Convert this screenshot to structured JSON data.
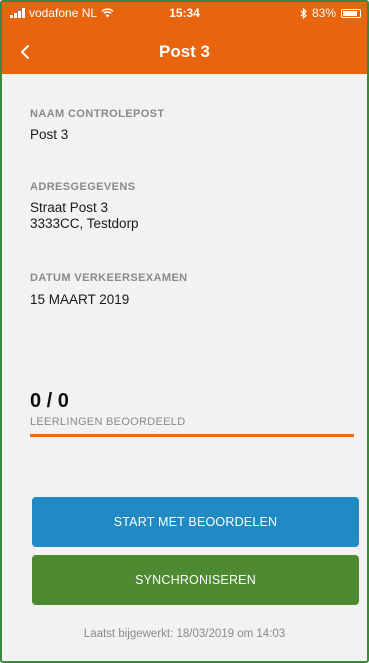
{
  "status_bar": {
    "carrier": "vodafone NL",
    "time": "15:34",
    "battery": "83%",
    "battery_level": 0.83
  },
  "nav": {
    "title": "Post 3",
    "back_icon": "chevron-left-icon"
  },
  "fields": {
    "naam": {
      "label": "NAAM CONTROLEPOST",
      "value": "Post 3"
    },
    "adres": {
      "label": "ADRESGEGEVENS",
      "line1": "Straat Post 3",
      "line2": "3333CC, Testdorp"
    },
    "datum": {
      "label": "DATUM VERKEERSEXAMEN",
      "value": "15 MAART 2019"
    }
  },
  "progress": {
    "count": "0 / 0",
    "label": "LEERLINGEN BEOORDEELD",
    "completed": 0,
    "total": 0
  },
  "buttons": {
    "start": "START MET BEOORDELEN",
    "sync": "SYNCHRONISEREN"
  },
  "footer": {
    "last_updated": "Laatst bijgewerkt: 18/03/2019 om 14:03"
  },
  "colors": {
    "header": "#e8640e",
    "start_button": "#1f8ac4",
    "sync_button": "#4d8a32",
    "progress": "#e06a16"
  }
}
